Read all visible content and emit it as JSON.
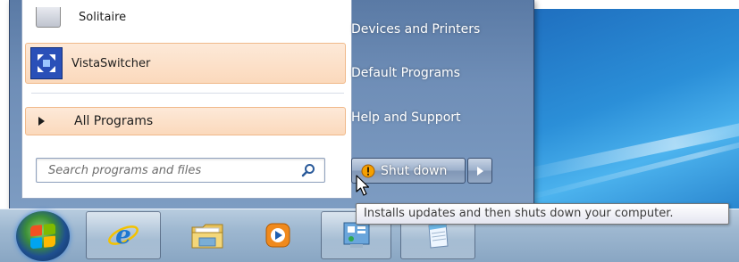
{
  "start_menu": {
    "programs": [
      {
        "label": "Solitaire",
        "icon": "solitaire-icon"
      },
      {
        "label": "VistaSwitcher",
        "icon": "vistaswitcher-icon"
      }
    ],
    "all_programs_label": "All Programs",
    "search": {
      "placeholder": "Search programs and files"
    },
    "right_links": [
      {
        "label": "Devices and Printers"
      },
      {
        "label": "Default Programs"
      },
      {
        "label": "Help and Support"
      }
    ],
    "shutdown": {
      "label": "Shut down",
      "icon": "update-shield-icon"
    }
  },
  "tooltip": {
    "text": "Installs updates and then shuts down your computer."
  },
  "taskbar": {
    "items": [
      {
        "name": "start-button",
        "icon": "windows-logo-icon"
      },
      {
        "name": "internet-explorer",
        "icon": "internet-explorer-icon"
      },
      {
        "name": "windows-explorer",
        "icon": "folder-icon"
      },
      {
        "name": "media-player",
        "icon": "media-player-icon"
      },
      {
        "name": "control-panel",
        "icon": "control-panel-icon"
      },
      {
        "name": "notepad",
        "icon": "notepad-icon"
      }
    ]
  },
  "colors": {
    "menu_frame": "#6f8eb7",
    "highlight": "#fbd9bc",
    "highlight_border": "#f0b98a",
    "desktop": "#2b8fd8"
  }
}
